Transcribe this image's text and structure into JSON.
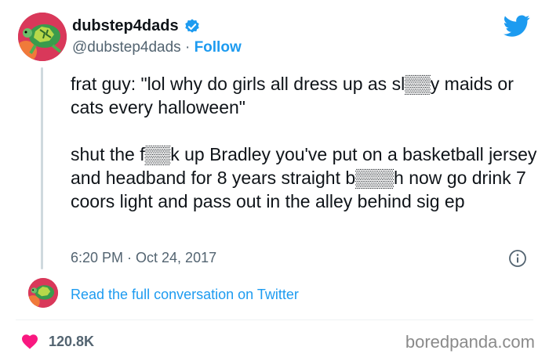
{
  "header": {
    "username": "dubstep4dads",
    "handle": "@dubstep4dads",
    "separator": "·",
    "follow_label": "Follow"
  },
  "icons": {
    "verified": "verified-badge-icon",
    "twitter": "twitter-bird-icon",
    "info": "info-icon",
    "like": "heart-icon"
  },
  "colors": {
    "accent": "#1d9bf0",
    "like": "#f91880",
    "secondary_text": "#536471"
  },
  "tweet": {
    "line1": "frat guy: \"lol why do girls all dress up as sl▒▒y maids or cats every halloween\"",
    "line2": "shut the f▒▒k up Bradley you've put on a basketball jersey and headband for 8 years straight b▒▒▒h now go drink 7 coors light and pass out in the alley behind sig ep"
  },
  "timestamp": "6:20 PM · Oct 24, 2017",
  "read_link": "Read the full conversation on Twitter",
  "likes_count": "120.8K",
  "watermark": "boredpanda.com"
}
